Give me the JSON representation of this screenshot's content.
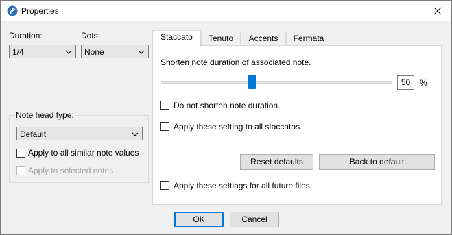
{
  "window": {
    "title": "Properties"
  },
  "duration": {
    "label": "Duration:",
    "value": "1/4"
  },
  "dots": {
    "label": "Dots:",
    "value": "None"
  },
  "note_head": {
    "group_label": "Note head type:",
    "value": "Default",
    "apply_similar": {
      "label": "Apply to all similar note values",
      "checked": false
    },
    "apply_selected": {
      "label": "Apply to selected notes",
      "checked": false,
      "enabled": false
    }
  },
  "tabs": [
    {
      "label": "Staccato",
      "active": true
    },
    {
      "label": "Tenuto",
      "active": false
    },
    {
      "label": "Accents",
      "active": false
    },
    {
      "label": "Fermata",
      "active": false
    }
  ],
  "staccato": {
    "description": "Shorten note duration of associated note.",
    "percent_value": "50",
    "percent_unit": "%",
    "slider_level": 0.39,
    "do_not_shorten": {
      "label": "Do not shorten note duration.",
      "checked": false
    },
    "apply_all_staccatos": {
      "label": "Apply these setting to all staccatos.",
      "checked": false
    },
    "reset_defaults_label": "Reset defaults",
    "back_to_default_label": "Back to default",
    "future_files": {
      "label": "Apply these settings for all future files.",
      "checked": false
    }
  },
  "footer": {
    "ok_label": "OK",
    "cancel_label": "Cancel"
  },
  "colors": {
    "accent": "#0078d7"
  },
  "icons": {
    "app": "music-app-icon",
    "close": "close-icon",
    "dropdown": "chevron-down-icon"
  }
}
